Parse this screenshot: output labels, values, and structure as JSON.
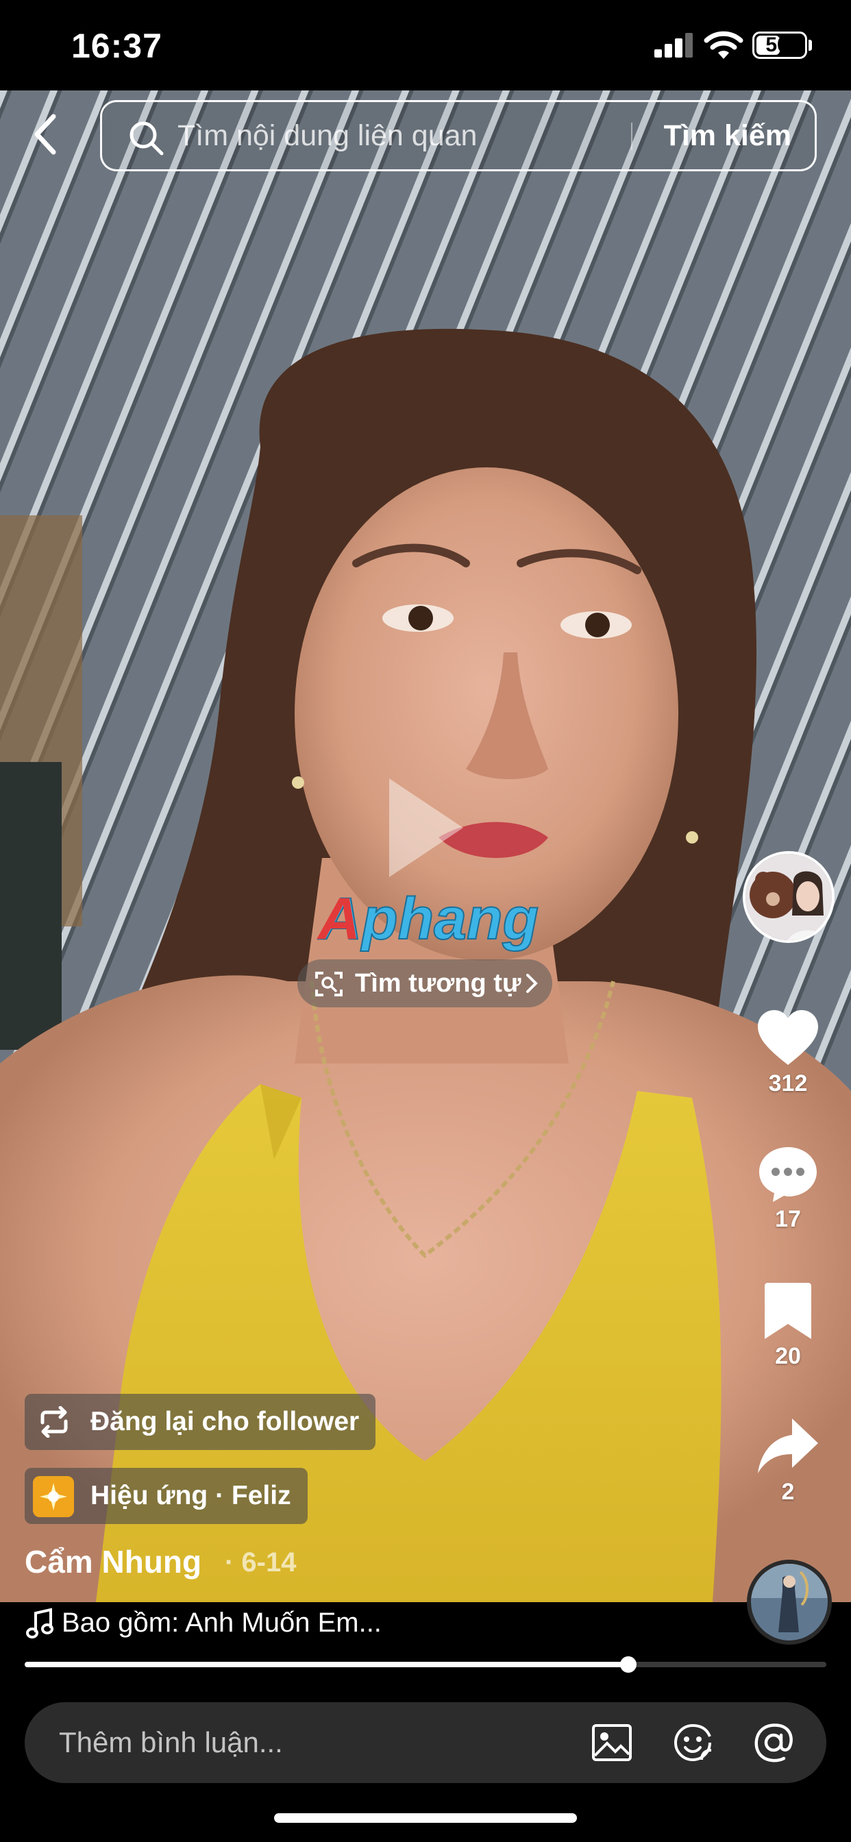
{
  "status_bar": {
    "time": "16:37",
    "battery": "50",
    "battery_level": 0.5
  },
  "header": {
    "search_placeholder": "Tìm nội dung liên quan",
    "search_button": "Tìm kiếm"
  },
  "video": {
    "watermark": "Aphang",
    "find_similar": "Tìm tương tự"
  },
  "actions": {
    "likes": "312",
    "comments": "17",
    "saves": "20",
    "shares": "2"
  },
  "post": {
    "repost": "Đăng lại cho follower",
    "effect": "Hiệu ứng · Feliz",
    "author": "Cẩm Nhung",
    "date": "· 6-14",
    "music": "Bao gồm: Anh Muốn Em..."
  },
  "playback": {
    "progress": 0.753
  },
  "comment_bar": {
    "placeholder": "Thêm bình luận..."
  },
  "colors": {
    "bg": "#000000",
    "comment_bar": "#2c2c2c",
    "effect_icon": "#f0a51c",
    "watermark_red": "#e23a3a",
    "watermark_blue": "#3db4e6"
  }
}
